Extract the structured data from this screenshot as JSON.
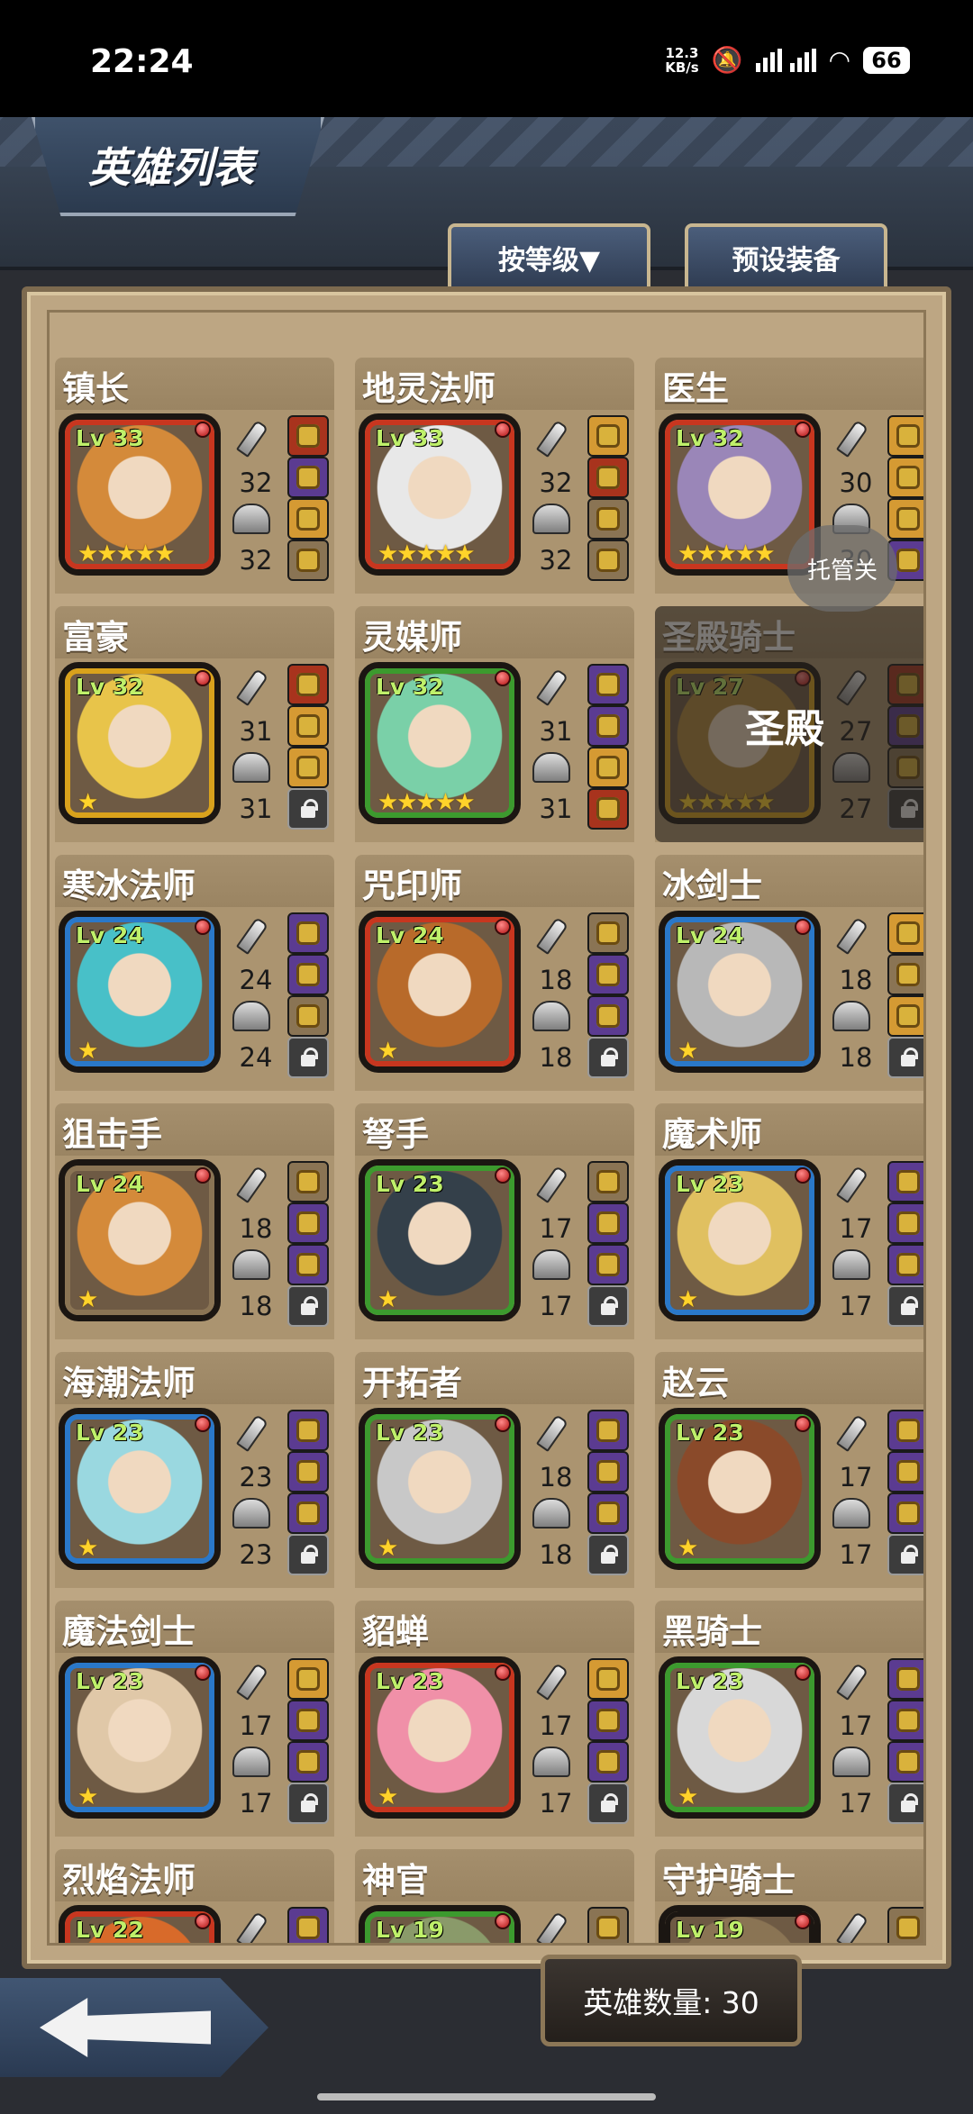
{
  "status_bar": {
    "time": "22:24",
    "net_speed_top": "12.3",
    "net_speed_bottom": "KB/s",
    "battery": "66"
  },
  "header": {
    "title": "英雄列表",
    "sort_label": "按等级▼",
    "preset_label": "预设装备"
  },
  "overlay": {
    "tuoguan": "托管关",
    "disabled_label": "圣殿"
  },
  "footer": {
    "hero_count": "英雄数量: 30"
  },
  "heroes": [
    {
      "name": "镇长",
      "level": "Lv 33",
      "stars": "★★★★★",
      "atk": "32",
      "def": "32",
      "frame": "#c8361f",
      "hair": "#d48a3a",
      "equip": [
        "r",
        "p",
        "o",
        "t"
      ]
    },
    {
      "name": "地灵法师",
      "level": "Lv 33",
      "stars": "★★★★★",
      "atk": "32",
      "def": "32",
      "frame": "#c8361f",
      "hair": "#e8e8e8",
      "equip": [
        "o",
        "r",
        "t",
        "t"
      ]
    },
    {
      "name": "医生",
      "level": "Lv 32",
      "stars": "★★★★★",
      "atk": "30",
      "def": "30",
      "frame": "#c8361f",
      "hair": "#9a86b8",
      "equip": [
        "o",
        "o",
        "o",
        "p"
      ]
    },
    {
      "name": "富豪",
      "level": "Lv 32",
      "stars": "★",
      "atk": "31",
      "def": "31",
      "frame": "#d9a21c",
      "hair": "#e8c44a",
      "equip": [
        "r",
        "o",
        "o",
        "lock"
      ]
    },
    {
      "name": "灵媒师",
      "level": "Lv 32",
      "stars": "★★★★★",
      "atk": "31",
      "def": "31",
      "frame": "#3c9a2e",
      "hair": "#7ad0a8",
      "equip": [
        "p",
        "p",
        "o",
        "r"
      ]
    },
    {
      "name": "圣殿骑士",
      "level": "Lv 27",
      "stars": "★★★★★",
      "atk": "27",
      "def": "27",
      "frame": "#d9a21c",
      "hair": "#b48a3a",
      "equip": [
        "r",
        "p",
        "t",
        "lock"
      ],
      "disabled": true
    },
    {
      "name": "寒冰法师",
      "level": "Lv 24",
      "stars": "★",
      "atk": "24",
      "def": "24",
      "frame": "#2a78c9",
      "hair": "#48c0c8",
      "equip": [
        "p",
        "p",
        "t",
        "lock"
      ]
    },
    {
      "name": "咒印师",
      "level": "Lv 24",
      "stars": "★",
      "atk": "18",
      "def": "18",
      "frame": "#c8361f",
      "hair": "#b86a2a",
      "equip": [
        "t",
        "p",
        "p",
        "lock"
      ]
    },
    {
      "name": "冰剑士",
      "level": "Lv 24",
      "stars": "★",
      "atk": "18",
      "def": "18",
      "frame": "#2a78c9",
      "hair": "#b8b8b8",
      "equip": [
        "o",
        "t",
        "o",
        "lock"
      ]
    },
    {
      "name": "狙击手",
      "level": "Lv 24",
      "stars": "★",
      "atk": "18",
      "def": "18",
      "frame": "#8a7454",
      "hair": "#d48a3a",
      "equip": [
        "t",
        "p",
        "p",
        "lock"
      ]
    },
    {
      "name": "弩手",
      "level": "Lv 23",
      "stars": "★",
      "atk": "17",
      "def": "17",
      "frame": "#3c9a2e",
      "hair": "#34404a",
      "equip": [
        "t",
        "p",
        "p",
        "lock"
      ]
    },
    {
      "name": "魔术师",
      "level": "Lv 23",
      "stars": "★",
      "atk": "17",
      "def": "17",
      "frame": "#2a78c9",
      "hair": "#e0c060",
      "equip": [
        "p",
        "p",
        "p",
        "lock"
      ]
    },
    {
      "name": "海潮法师",
      "level": "Lv 23",
      "stars": "★",
      "atk": "23",
      "def": "23",
      "frame": "#2a78c9",
      "hair": "#9ad8e0",
      "equip": [
        "p",
        "p",
        "p",
        "lock"
      ]
    },
    {
      "name": "开拓者",
      "level": "Lv 23",
      "stars": "★",
      "atk": "18",
      "def": "18",
      "frame": "#3c9a2e",
      "hair": "#c8c8c8",
      "equip": [
        "p",
        "p",
        "p",
        "lock"
      ]
    },
    {
      "name": "赵云",
      "level": "Lv 23",
      "stars": "★",
      "atk": "17",
      "def": "17",
      "frame": "#3c9a2e",
      "hair": "#8a4a2a",
      "equip": [
        "p",
        "p",
        "p",
        "lock"
      ]
    },
    {
      "name": "魔法剑士",
      "level": "Lv 23",
      "stars": "★",
      "atk": "17",
      "def": "17",
      "frame": "#2a78c9",
      "hair": "#e0c8a8",
      "equip": [
        "o",
        "p",
        "p",
        "lock"
      ]
    },
    {
      "name": "貂蝉",
      "level": "Lv 23",
      "stars": "★",
      "atk": "17",
      "def": "17",
      "frame": "#c8361f",
      "hair": "#f090a8",
      "equip": [
        "o",
        "p",
        "p",
        "lock"
      ]
    },
    {
      "name": "黑骑士",
      "level": "Lv 23",
      "stars": "★",
      "atk": "17",
      "def": "17",
      "frame": "#3c9a2e",
      "hair": "#d8d8d8",
      "equip": [
        "p",
        "p",
        "p",
        "lock"
      ]
    },
    {
      "name": "烈焰法师",
      "level": "Lv 22",
      "stars": "",
      "atk": "",
      "def": "",
      "frame": "#c8361f",
      "hair": "#d86a2a",
      "equip": [
        "p"
      ]
    },
    {
      "name": "神官",
      "level": "Lv 19",
      "stars": "",
      "atk": "",
      "def": "",
      "frame": "#3c9a2e",
      "hair": "#8a9a6a",
      "equip": [
        "t"
      ]
    },
    {
      "name": "守护骑士",
      "level": "Lv 19",
      "stars": "",
      "atk": "",
      "def": "",
      "frame": "#1b1612",
      "hair": "#8a7454",
      "equip": [
        "t"
      ]
    }
  ]
}
